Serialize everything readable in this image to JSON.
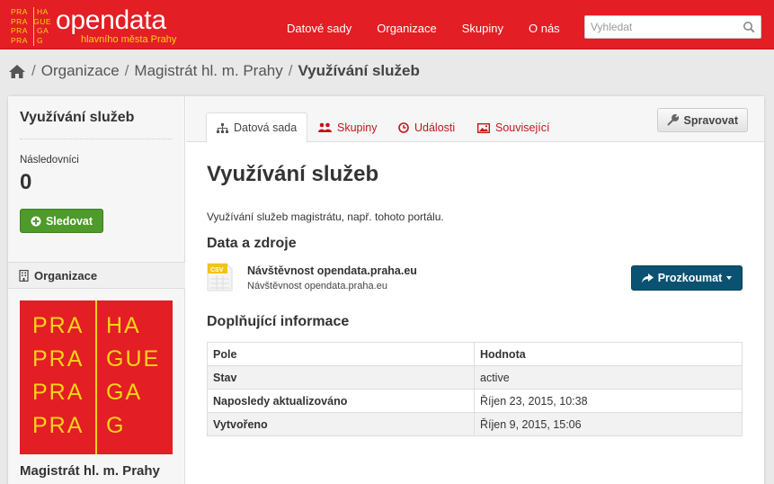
{
  "header": {
    "logo_text": "opendata",
    "logo_subtitle": "hlavního města Prahy",
    "logo_mark": [
      [
        "PRA",
        "HA"
      ],
      [
        "PRA",
        "GUE"
      ],
      [
        "PRA",
        "GA"
      ],
      [
        "PRA",
        "G"
      ]
    ],
    "nav": [
      "Datové sady",
      "Organizace",
      "Skupiny",
      "O nás"
    ],
    "search_placeholder": "Vyhledat",
    "brand_color": "#e31e24",
    "accent_color": "#f7d417"
  },
  "breadcrumb": {
    "home_icon": "home-icon",
    "items": [
      "Organizace",
      "Magistrát hl. m. Prahy"
    ],
    "current": "Využívání služeb"
  },
  "sidebar": {
    "title": "Využívání služeb",
    "followers_label": "Následovníci",
    "followers_count": "0",
    "follow_label": "Sledovat",
    "org_section_label": "Organizace",
    "org_logo": [
      [
        "PRA",
        "HA"
      ],
      [
        "PRA",
        "GUE"
      ],
      [
        "PRA",
        "GA"
      ],
      [
        "PRA",
        "G"
      ]
    ],
    "org_name": "Magistrát hl. m. Prahy"
  },
  "tabs": [
    {
      "label": "Datová sada",
      "icon": "sitemap-icon",
      "active": true
    },
    {
      "label": "Skupiny",
      "icon": "users-icon",
      "active": false
    },
    {
      "label": "Události",
      "icon": "clock-icon",
      "active": false
    },
    {
      "label": "Související",
      "icon": "picture-icon",
      "active": false
    }
  ],
  "manage_label": "Spravovat",
  "dataset": {
    "title": "Využívání služeb",
    "description": "Využívání služeb magistrátu, např. tohoto portálu.",
    "resources_heading": "Data a zdroje",
    "resource": {
      "format": "CSV",
      "title": "Návštěvnost opendata.praha.eu",
      "subtitle": "Návštěvnost opendata.praha.eu",
      "explore_label": "Prozkoumat"
    },
    "info_heading": "Doplňující informace",
    "info_table": {
      "headers": [
        "Pole",
        "Hodnota"
      ],
      "rows": [
        [
          "Stav",
          "active"
        ],
        [
          "Naposledy aktualizováno",
          "Říjen 23, 2015, 10:38"
        ],
        [
          "Vytvořeno",
          "Říjen 9, 2015, 15:06"
        ]
      ]
    }
  }
}
